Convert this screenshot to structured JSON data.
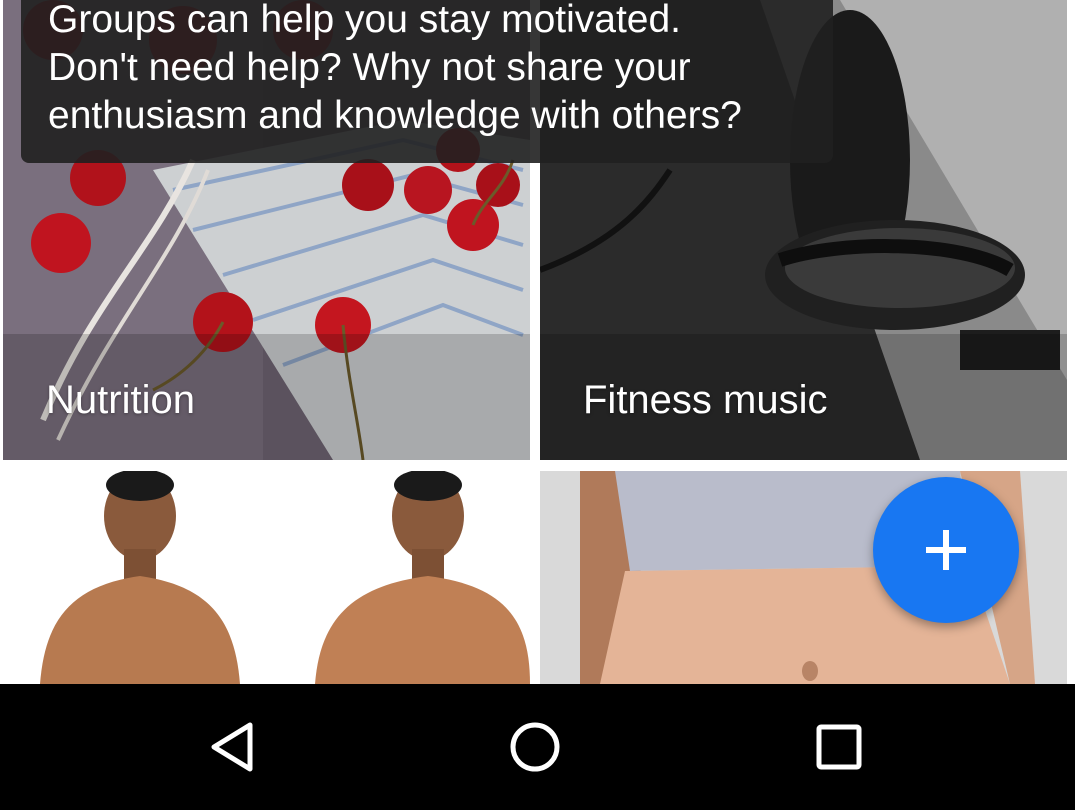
{
  "tooltip": {
    "lines": [
      "Groups can help you stay motivated.",
      "Don't need help? Why not share your",
      "enthusiasm and knowledge with others?"
    ]
  },
  "groups": [
    {
      "label": "Nutrition",
      "icon": "cherries-photo"
    },
    {
      "label": "Fitness music",
      "icon": "headphones-photo"
    },
    {
      "label": "",
      "icon": "body-transformation-photo"
    },
    {
      "label": "",
      "icon": "abs-photo"
    }
  ],
  "fab": {
    "icon": "plus-icon",
    "color": "#1877f2"
  },
  "navbar": {
    "back_icon": "back-triangle-icon",
    "home_icon": "home-circle-icon",
    "recents_icon": "recents-square-icon"
  }
}
